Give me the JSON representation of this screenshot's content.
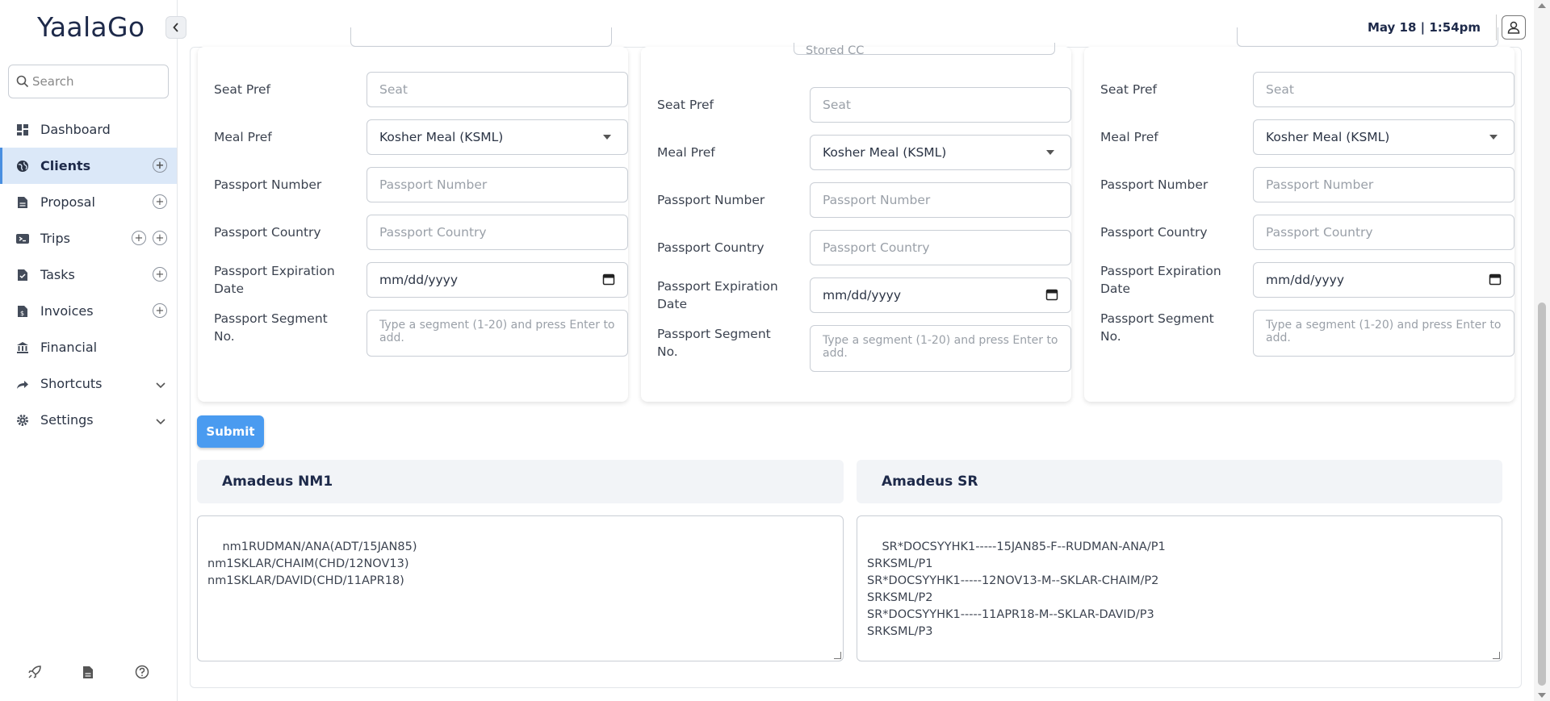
{
  "app": {
    "logo": "YaalaGo"
  },
  "header": {
    "datetime": "May 18 | 1:54pm"
  },
  "search": {
    "placeholder": "Search"
  },
  "sidebar": {
    "items": [
      {
        "label": "Dashboard",
        "icon": "dashboard-icon"
      },
      {
        "label": "Clients",
        "icon": "globe-icon"
      },
      {
        "label": "Proposal",
        "icon": "document-icon"
      },
      {
        "label": "Trips",
        "icon": "ticket-icon"
      },
      {
        "label": "Tasks",
        "icon": "task-icon"
      },
      {
        "label": "Invoices",
        "icon": "invoice-icon"
      },
      {
        "label": "Financial",
        "icon": "bank-icon"
      },
      {
        "label": "Shortcuts",
        "icon": "share-icon"
      },
      {
        "label": "Settings",
        "icon": "gear-icon"
      }
    ]
  },
  "cards": [
    {
      "stored_cc": "",
      "seat_label": "Seat Pref",
      "seat_placeholder": "Seat",
      "meal_label": "Meal Pref",
      "meal_value": "Kosher Meal (KSML)",
      "passport_number_label": "Passport Number",
      "passport_number_placeholder": "Passport Number",
      "passport_country_label": "Passport Country",
      "passport_country_placeholder": "Passport Country",
      "passport_exp_label": "Passport Expiration Date",
      "passport_exp_value": "mm/dd/yyyy",
      "passport_seg_label": "Passport Segment No.",
      "passport_seg_placeholder": "Type a segment (1-20) and press Enter to add."
    },
    {
      "stored_cc": "Stored CC",
      "seat_label": "Seat Pref",
      "seat_placeholder": "Seat",
      "meal_label": "Meal Pref",
      "meal_value": "Kosher Meal (KSML)",
      "passport_number_label": "Passport Number",
      "passport_number_placeholder": "Passport Number",
      "passport_country_label": "Passport Country",
      "passport_country_placeholder": "Passport Country",
      "passport_exp_label": "Passport Expiration Date",
      "passport_exp_value": "mm/dd/yyyy",
      "passport_seg_label": "Passport Segment No.",
      "passport_seg_placeholder": "Type a segment (1-20) and press Enter to add."
    },
    {
      "stored_cc": "",
      "seat_label": "Seat Pref",
      "seat_placeholder": "Seat",
      "meal_label": "Meal Pref",
      "meal_value": "Kosher Meal (KSML)",
      "passport_number_label": "Passport Number",
      "passport_number_placeholder": "Passport Number",
      "passport_country_label": "Passport Country",
      "passport_country_placeholder": "Passport Country",
      "passport_exp_label": "Passport Expiration Date",
      "passport_exp_value": "mm/dd/yyyy",
      "passport_seg_label": "Passport Segment No.",
      "passport_seg_placeholder": "Type a segment (1-20) and press Enter to add."
    }
  ],
  "submit_label": "Submit",
  "amadeus_nm1": {
    "title": "Amadeus NM1",
    "text": "nm1RUDMAN/ANA(ADT/15JAN85)\nnm1SKLAR/CHAIM(CHD/12NOV13)\nnm1SKLAR/DAVID(CHD/11APR18)"
  },
  "amadeus_sr": {
    "title": "Amadeus SR",
    "text": "SR*DOCSYYHK1-----15JAN85-F--RUDMAN-ANA/P1\nSRKSML/P1\nSR*DOCSYYHK1-----12NOV13-M--SKLAR-CHAIM/P2\nSRKSML/P2\nSR*DOCSYYHK1-----11APR18-M--SKLAR-DAVID/P3\nSRKSML/P3"
  },
  "colors": {
    "accent": "#4a9bf0",
    "active_bg": "#dbe8f8",
    "brand": "#1e2a4a"
  }
}
